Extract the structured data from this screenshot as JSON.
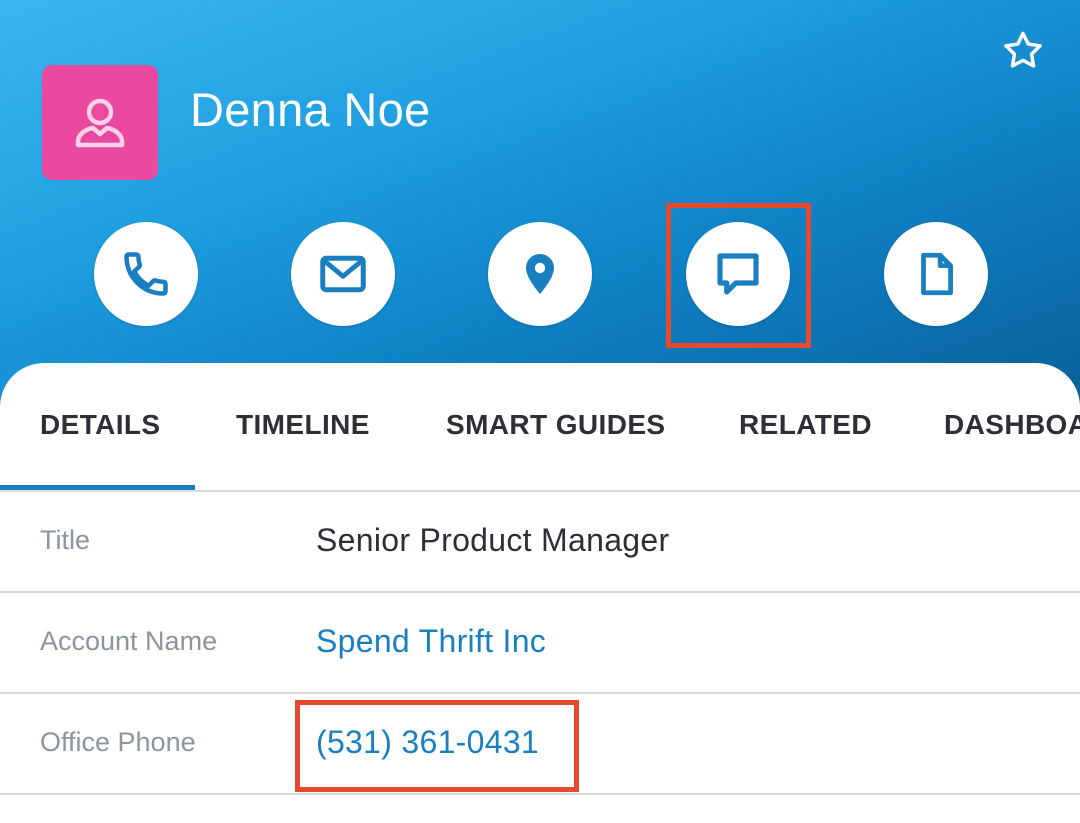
{
  "record": {
    "name": "Denna Noe",
    "avatar_color": "#e94aa0",
    "avatar_icon": "person-icon",
    "favorite_icon": "star-outline-icon"
  },
  "actions": [
    {
      "name": "call",
      "icon": "phone-icon"
    },
    {
      "name": "email",
      "icon": "envelope-icon"
    },
    {
      "name": "map",
      "icon": "map-pin-icon"
    },
    {
      "name": "message",
      "icon": "chat-bubble-icon"
    },
    {
      "name": "note",
      "icon": "document-icon"
    }
  ],
  "tabs": [
    {
      "label": "DETAILS",
      "active": true
    },
    {
      "label": "TIMELINE"
    },
    {
      "label": "SMART GUIDES"
    },
    {
      "label": "RELATED"
    },
    {
      "label": "DASHBOARD"
    }
  ],
  "details": [
    {
      "label": "Title",
      "value": "Senior Product Manager"
    },
    {
      "label": "Account Name",
      "value": "Spend Thrift Inc"
    },
    {
      "label": "Office Phone",
      "value": "(531) 361-0431"
    }
  ],
  "colors": {
    "accent": "#1a7fc0",
    "highlight_box": "#e64a2e",
    "header_gradient_start": "#3ab5f0",
    "header_gradient_end": "#0a5f96"
  }
}
